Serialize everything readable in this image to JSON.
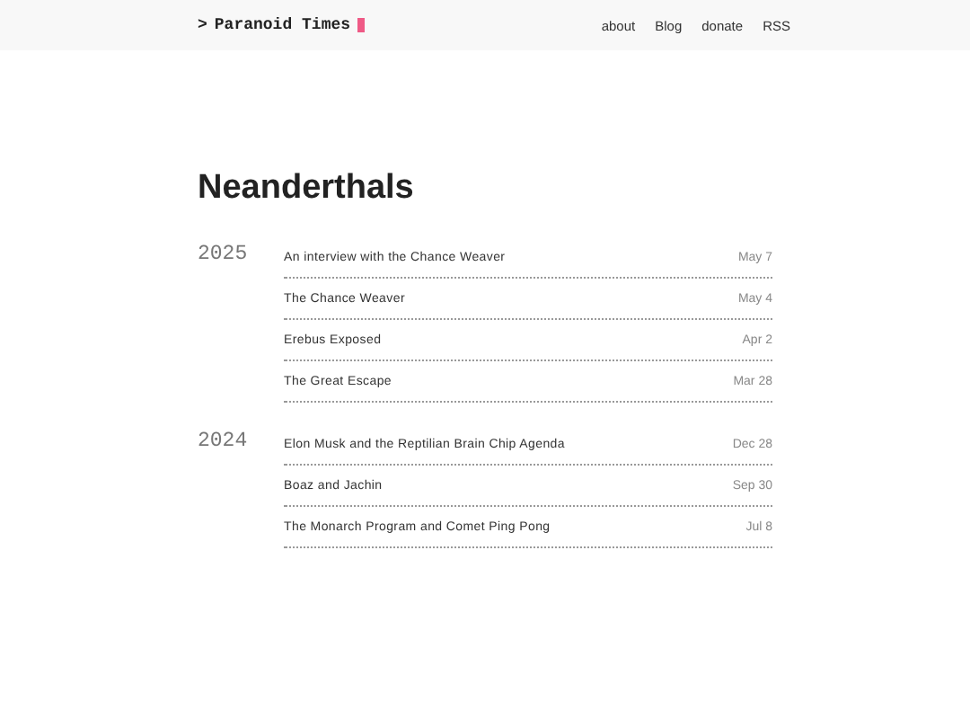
{
  "header": {
    "prompt": ">",
    "site_title": "Paranoid Times",
    "nav": [
      "about",
      "Blog",
      "donate",
      "RSS"
    ]
  },
  "page_title": "Neanderthals",
  "groups": [
    {
      "year": "2025",
      "posts": [
        {
          "title": "An interview with the Chance Weaver",
          "date": "May 7"
        },
        {
          "title": "The Chance Weaver",
          "date": "May 4"
        },
        {
          "title": "Erebus Exposed",
          "date": "Apr 2"
        },
        {
          "title": "The Great Escape",
          "date": "Mar 28"
        }
      ]
    },
    {
      "year": "2024",
      "posts": [
        {
          "title": "Elon Musk and the Reptilian Brain Chip Agenda",
          "date": "Dec 28"
        },
        {
          "title": "Boaz and Jachin",
          "date": "Sep 30"
        },
        {
          "title": "The Monarch Program and Comet Ping Pong",
          "date": "Jul 8"
        }
      ]
    }
  ]
}
